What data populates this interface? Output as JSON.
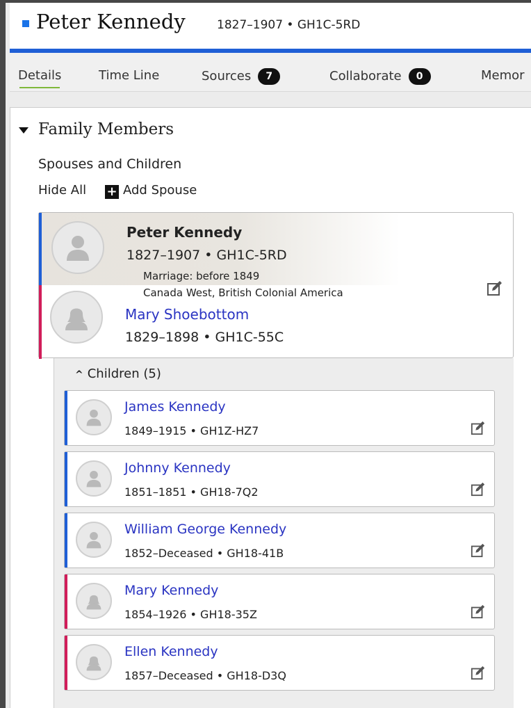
{
  "header": {
    "name": "Peter Kennedy",
    "meta": "1827–1907 • GH1C-5RD"
  },
  "tabs": [
    {
      "label": "Details",
      "badge": null,
      "active": true
    },
    {
      "label": "Time Line",
      "badge": null
    },
    {
      "label": "Sources",
      "badge": "7"
    },
    {
      "label": "Collaborate",
      "badge": "0"
    },
    {
      "label": "Memor",
      "badge": null
    }
  ],
  "family": {
    "title": "Family Members",
    "section": "Spouses and Children",
    "hide_all": "Hide All",
    "add_spouse": "Add Spouse",
    "husband": {
      "name": "Peter Kennedy",
      "meta": "1827–1907 •  GH1C-5RD"
    },
    "marriage": {
      "line1": "Marriage: before 1849",
      "line2": "Canada West, British Colonial America"
    },
    "wife": {
      "name": "Mary Shoebottom",
      "meta": "1829–1898 •  GH1C-55C"
    },
    "children_toggle": "Children (5)",
    "children": [
      {
        "name": "James Kennedy",
        "meta": "1849–1915 •  GH1Z-HZ7",
        "sex": "male"
      },
      {
        "name": "Johnny Kennedy",
        "meta": "1851–1851 •  GH18-7Q2",
        "sex": "male"
      },
      {
        "name": "William George Kennedy",
        "meta": "1852–Deceased •  GH18-41B",
        "sex": "male"
      },
      {
        "name": "Mary Kennedy",
        "meta": "1854–1926 •  GH18-35Z",
        "sex": "female"
      },
      {
        "name": "Ellen Kennedy",
        "meta": "1857–Deceased •  GH18-D3Q",
        "sex": "female"
      }
    ]
  },
  "colors": {
    "male": "#1f5fd6",
    "female": "#d11d5a",
    "link": "#2a34c2"
  },
  "icons": [
    "collapse-triangle-icon",
    "plus-icon",
    "person-silhouette-icon",
    "edit-icon",
    "caret-up-icon"
  ]
}
